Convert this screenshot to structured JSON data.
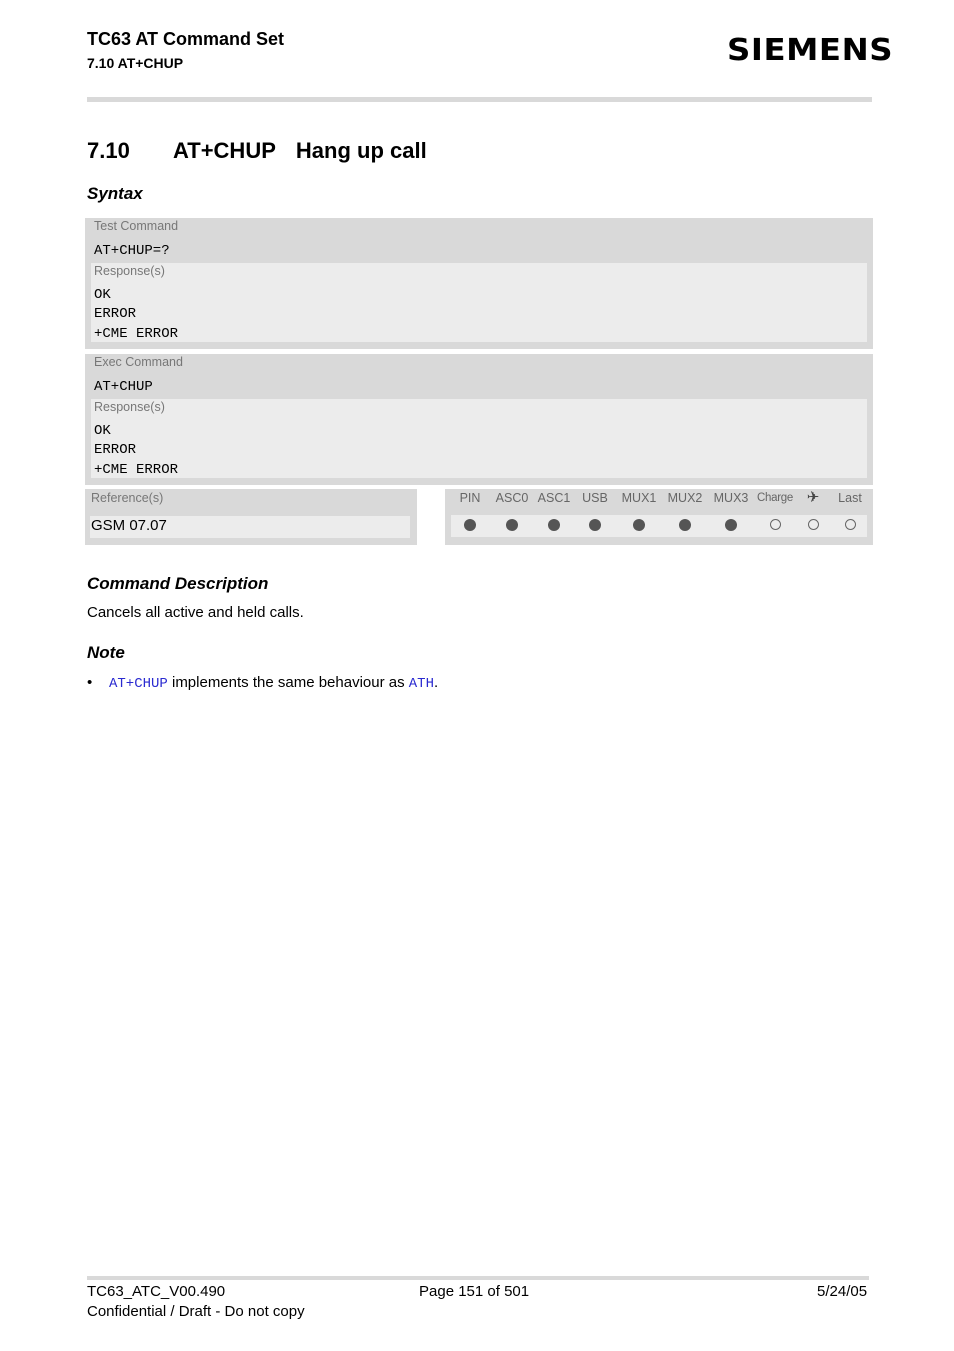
{
  "header": {
    "doc_title": "TC63 AT Command Set",
    "section_ref": "7.10 AT+CHUP",
    "brand": "SIEMENS"
  },
  "section": {
    "number": "7.10",
    "command": "AT+CHUP",
    "title": "Hang up call"
  },
  "syntax": {
    "heading": "Syntax",
    "blocks": [
      {
        "type_label": "Test Command",
        "command": "AT+CHUP=?",
        "responses_label": "Response(s)",
        "responses": [
          "OK",
          "ERROR",
          "+CME ERROR"
        ]
      },
      {
        "type_label": "Exec Command",
        "command": "AT+CHUP",
        "responses_label": "Response(s)",
        "responses": [
          "OK",
          "ERROR",
          "+CME ERROR"
        ]
      }
    ],
    "reference": {
      "label": "Reference(s)",
      "value": "GSM 07.07"
    },
    "pin_table": {
      "columns": [
        {
          "label": "PIN",
          "supported": true
        },
        {
          "label": "ASC0",
          "supported": true
        },
        {
          "label": "ASC1",
          "supported": true
        },
        {
          "label": "USB",
          "supported": true
        },
        {
          "label": "MUX1",
          "supported": true
        },
        {
          "label": "MUX2",
          "supported": true
        },
        {
          "label": "MUX3",
          "supported": true
        },
        {
          "label": "Charge",
          "supported": false
        },
        {
          "label": "✈",
          "icon": "airplane-icon",
          "supported": false
        },
        {
          "label": "Last",
          "supported": false
        }
      ]
    }
  },
  "description": {
    "heading": "Command Description",
    "text": "Cancels all active and held calls."
  },
  "note": {
    "heading": "Note",
    "bullet": "•",
    "link1": "AT+CHUP",
    "middle": " implements the same behaviour as ",
    "link2": "ATH",
    "end": "."
  },
  "footer": {
    "doc_id": "TC63_ATC_V00.490",
    "page": "Page 151 of 501",
    "date": "5/24/05",
    "confidential": "Confidential / Draft - Do not copy"
  },
  "colors": {
    "box_dark": "#d9d9d9",
    "box_light": "#ececec",
    "link": "#2a2ad0"
  }
}
